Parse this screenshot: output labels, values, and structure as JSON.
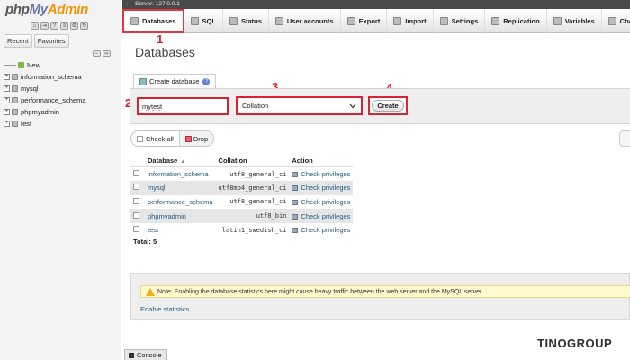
{
  "server": {
    "label": "Server: 127.0.0.1"
  },
  "sidebar": {
    "logo": {
      "php": "php",
      "my": "My",
      "admin": "Admin"
    },
    "tabs": [
      "Recent",
      "Favorites"
    ],
    "new_label": "New",
    "databases": [
      "information_schema",
      "mysql",
      "performance_schema",
      "phpmyadmin",
      "test"
    ]
  },
  "nav": {
    "tabs": [
      "Databases",
      "SQL",
      "Status",
      "User accounts",
      "Export",
      "Import",
      "Settings",
      "Replication",
      "Variables",
      "Charsets"
    ]
  },
  "page": {
    "title": "Databases"
  },
  "annotations": [
    "1",
    "2",
    "3",
    "4"
  ],
  "create": {
    "tab_label": "Create database",
    "name_value": "mytest",
    "collation_label": "Collation",
    "button_label": "Create"
  },
  "actions": {
    "check_all": "Check all",
    "drop": "Drop"
  },
  "table": {
    "headers": [
      "Database",
      "Collation",
      "Action"
    ],
    "rows": [
      {
        "db": "information_schema",
        "collation": "utf8_general_ci",
        "action": "Check privileges"
      },
      {
        "db": "mysql",
        "collation": "utf8mb4_general_ci",
        "action": "Check privileges"
      },
      {
        "db": "performance_schema",
        "collation": "utf8_general_ci",
        "action": "Check privileges"
      },
      {
        "db": "phpmyadmin",
        "collation": "utf8_bin",
        "action": "Check privileges"
      },
      {
        "db": "test",
        "collation": "latin1_swedish_ci",
        "action": "Check privileges"
      }
    ],
    "total": "Total: 5"
  },
  "stats": {
    "note": "Note: Enabling the database statistics here might cause heavy traffic between the web server and the MySQL server.",
    "link": "Enable statistics"
  },
  "console": {
    "label": "Console"
  },
  "watermark": {
    "text": "TINOGROUP"
  },
  "colors": {
    "annotation": "#d9232e",
    "link": "#235a81",
    "logo": "#6c78af"
  }
}
